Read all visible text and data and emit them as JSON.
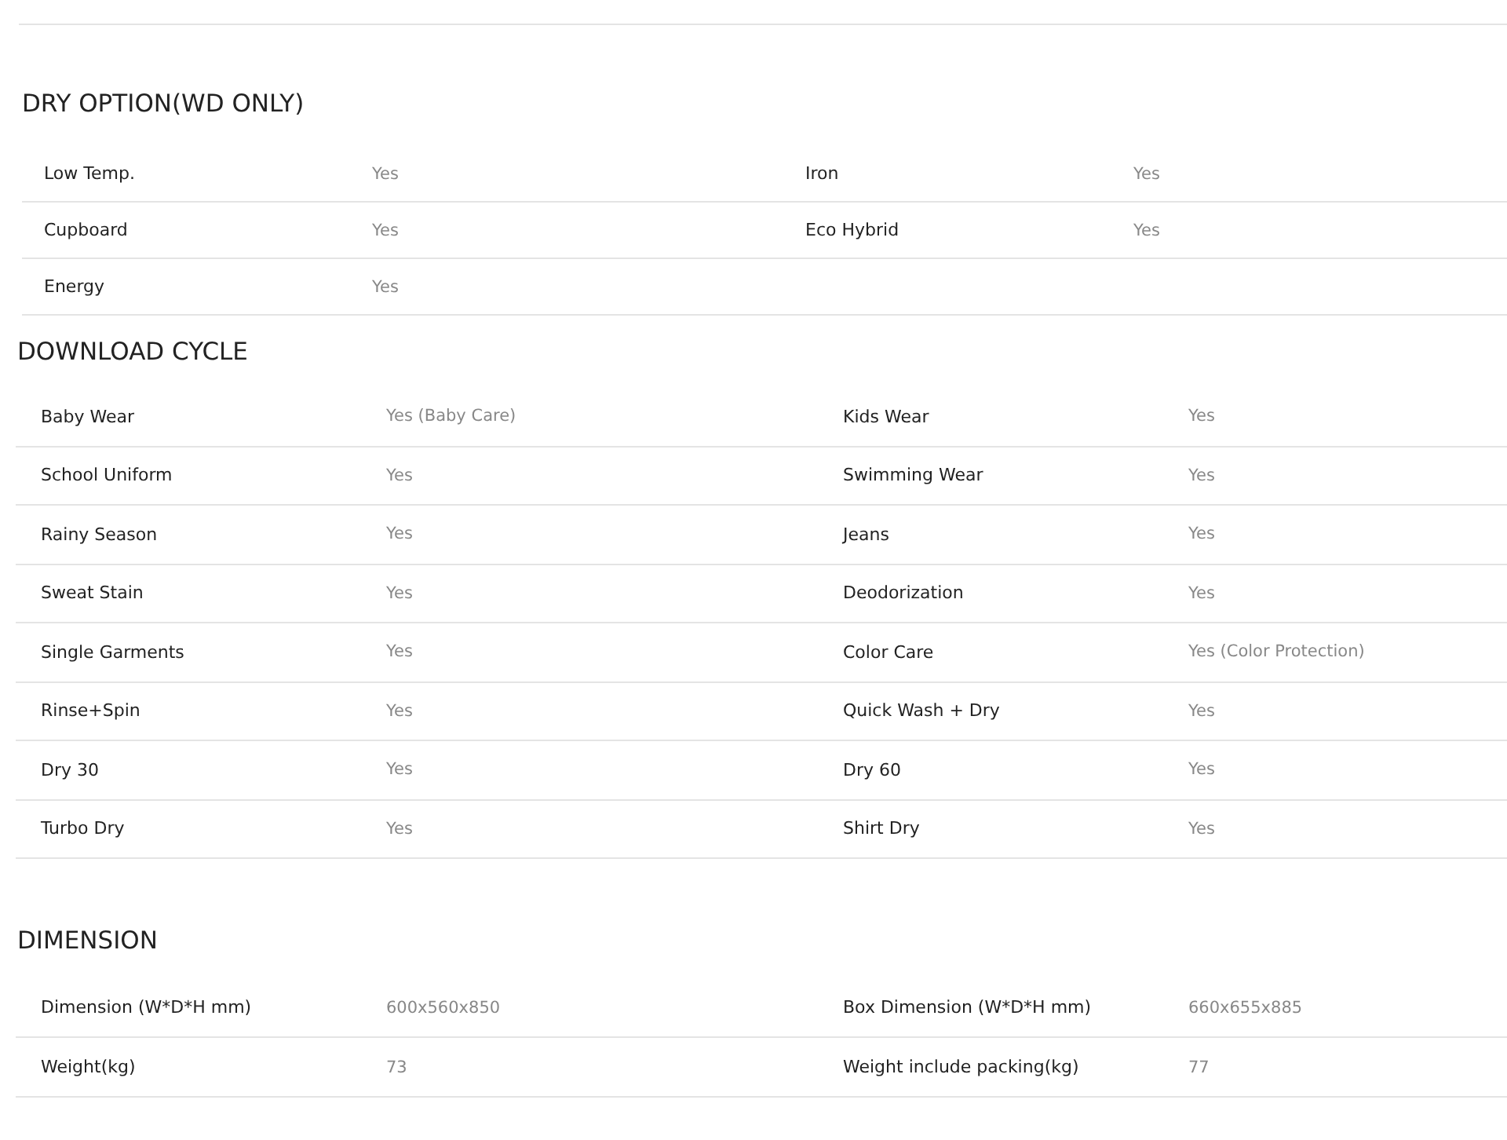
{
  "sections": [
    {
      "title": "DRY OPTION(WD ONLY)",
      "kind": "compact",
      "rows": [
        [
          {
            "label": "Low Temp.",
            "value": "Yes"
          },
          {
            "label": "Iron",
            "value": "Yes"
          }
        ],
        [
          {
            "label": "Cupboard",
            "value": "Yes"
          },
          {
            "label": "Eco Hybrid",
            "value": "Yes"
          }
        ],
        [
          {
            "label": "Energy",
            "value": "Yes"
          }
        ]
      ]
    },
    {
      "title": "DOWNLOAD CYCLE",
      "kind": "wide",
      "rows": [
        [
          {
            "label": "Baby Wear",
            "value": "Yes (Baby Care)"
          },
          {
            "label": "Kids Wear",
            "value": "Yes"
          }
        ],
        [
          {
            "label": "School Uniform",
            "value": "Yes"
          },
          {
            "label": "Swimming Wear",
            "value": "Yes"
          }
        ],
        [
          {
            "label": "Rainy Season",
            "value": "Yes"
          },
          {
            "label": "Jeans",
            "value": "Yes"
          }
        ],
        [
          {
            "label": "Sweat Stain",
            "value": "Yes"
          },
          {
            "label": "Deodorization",
            "value": "Yes"
          }
        ],
        [
          {
            "label": "Single Garments",
            "value": "Yes"
          },
          {
            "label": "Color Care",
            "value": "Yes (Color Protection)"
          }
        ],
        [
          {
            "label": "Rinse+Spin",
            "value": "Yes"
          },
          {
            "label": "Quick Wash + Dry",
            "value": "Yes"
          }
        ],
        [
          {
            "label": "Dry 30",
            "value": "Yes"
          },
          {
            "label": "Dry 60",
            "value": "Yes"
          }
        ],
        [
          {
            "label": "Turbo Dry",
            "value": "Yes"
          },
          {
            "label": "Shirt Dry",
            "value": "Yes"
          }
        ]
      ]
    },
    {
      "title": "DIMENSION",
      "kind": "wide",
      "rows": [
        [
          {
            "label": "Dimension (W*D*H mm)",
            "value": "600x560x850"
          },
          {
            "label": "Box Dimension (W*D*H mm)",
            "value": "660x655x885"
          }
        ],
        [
          {
            "label": "Weight(kg)",
            "value": "73"
          },
          {
            "label": "Weight include packing(kg)",
            "value": "77"
          }
        ]
      ]
    }
  ]
}
